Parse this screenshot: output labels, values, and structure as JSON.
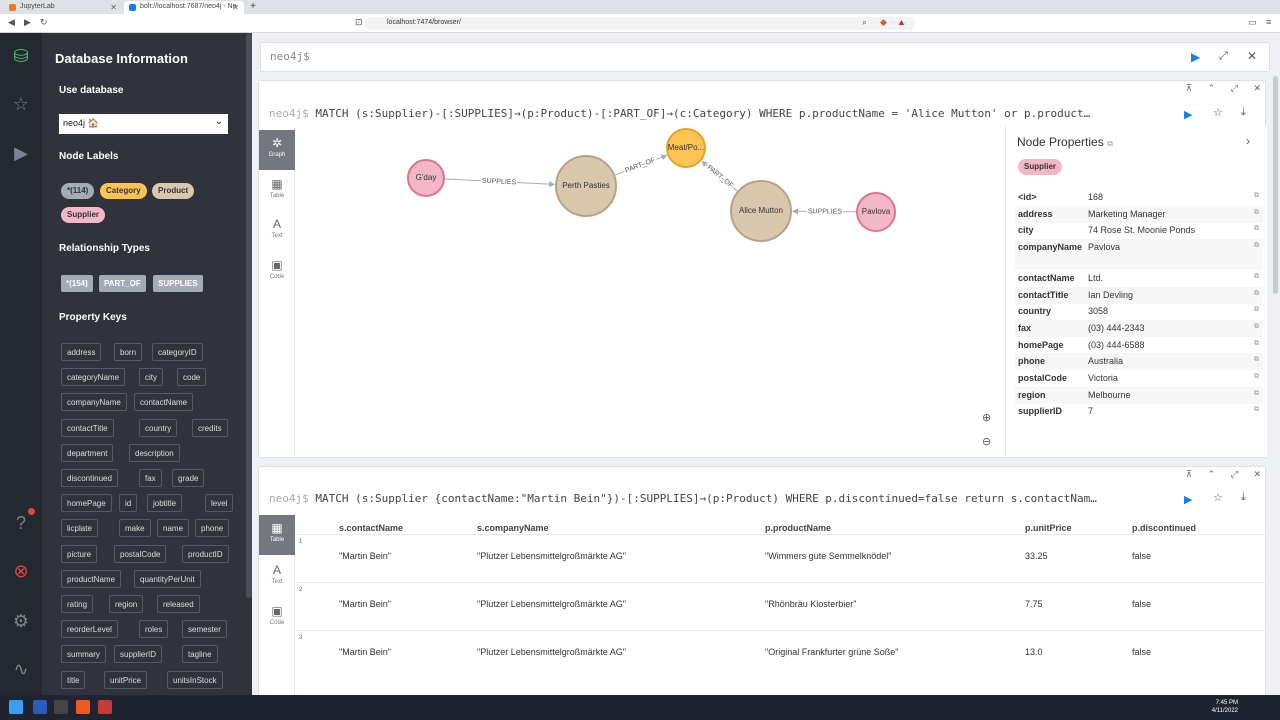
{
  "browser": {
    "tabs": [
      {
        "label": "JupyterLab",
        "color": "#f37726"
      },
      {
        "label": "bolt://localhost:7687/neo4j - Ne",
        "color": "#1581e6"
      }
    ],
    "url": "localhost:7474/browser/"
  },
  "sidebar": {
    "title": "Database Information",
    "use_database": "Use database",
    "db_value": "neo4j 🏠",
    "node_labels_title": "Node Labels",
    "node_labels": [
      {
        "label": "*(114)",
        "color": "#a5abb6"
      },
      {
        "label": "Category",
        "color": "#ffc454"
      },
      {
        "label": "Product",
        "color": "#d9c8ae"
      },
      {
        "label": "Supplier",
        "color": "#f3b7c8"
      }
    ],
    "rel_types_title": "Relationship Types",
    "rel_types": [
      "*(154)",
      "PART_OF",
      "SUPPLIES"
    ],
    "prop_keys_title": "Property Keys",
    "prop_keys": [
      [
        "address",
        "born",
        "categoryID"
      ],
      [
        "categoryName",
        "city",
        "code"
      ],
      [
        "companyName",
        "contactName"
      ],
      [
        "contactTitle",
        "country",
        "credits"
      ],
      [
        "department",
        "description"
      ],
      [
        "discontinued",
        "fax",
        "grade"
      ],
      [
        "homePage",
        "id",
        "jobtitle",
        "level"
      ],
      [
        "licplate",
        "make",
        "name",
        "phone"
      ],
      [
        "picture",
        "postalCode",
        "productID"
      ],
      [
        "productName",
        "quantityPerUnit"
      ],
      [
        "rating",
        "region",
        "released"
      ],
      [
        "reorderLevel",
        "roles",
        "semester"
      ],
      [
        "summary",
        "supplierID",
        "tagline"
      ],
      [
        "title",
        "unitPrice",
        "unitsInStock"
      ]
    ]
  },
  "editor": {
    "prompt": "neo4j$"
  },
  "frame1": {
    "query": "MATCH (s:Supplier)-[:SUPPLIES]→(p:Product)-[:PART_OF]→(c:Category) WHERE p.productName = 'Alice Mutton' or p.product…",
    "prompt": "neo4j$",
    "view_tabs": [
      "Graph",
      "Table",
      "Text",
      "Code"
    ],
    "graph": {
      "nodes": [
        {
          "id": "gday",
          "label": "G'day",
          "color": "#f3b7c8",
          "stroke": "#d9768f"
        },
        {
          "id": "perth",
          "label": "Perth Pasties",
          "color": "#d9c8ae",
          "stroke": "#b5a287"
        },
        {
          "id": "meat",
          "label": "Meat/Po...",
          "color": "#ffc454",
          "stroke": "#e0a42b"
        },
        {
          "id": "alice",
          "label": "Alice Mutton",
          "color": "#d9c8ae",
          "stroke": "#b5a287"
        },
        {
          "id": "pavlova",
          "label": "Pavlova",
          "color": "#f3b7c8",
          "stroke": "#d9768f"
        }
      ],
      "edges": [
        {
          "label": "SUPPLIES"
        },
        {
          "label": "PART_OF"
        },
        {
          "label": "PART_OF"
        },
        {
          "label": "SUPPLIES"
        }
      ]
    },
    "props": {
      "title": "Node Properties",
      "label": "Supplier",
      "rows": [
        {
          "k": "<id>",
          "v": "168"
        },
        {
          "k": "address",
          "v": "Marketing Manager"
        },
        {
          "k": "city",
          "v": "74 Rose St. Moonie Ponds"
        },
        {
          "k": "companyName",
          "v": "Pavlova"
        },
        {
          "k": "contactName",
          "v": "Ltd."
        },
        {
          "k": "contactTitle",
          "v": "Ian Devling"
        },
        {
          "k": "country",
          "v": "3058"
        },
        {
          "k": "fax",
          "v": "(03) 444-2343"
        },
        {
          "k": "homePage",
          "v": "(03) 444-6588"
        },
        {
          "k": "phone",
          "v": "Australia"
        },
        {
          "k": "postalCode",
          "v": "Victoria"
        },
        {
          "k": "region",
          "v": "Melbourne"
        },
        {
          "k": "supplierID",
          "v": "7"
        }
      ]
    }
  },
  "frame2": {
    "prompt": "neo4j$",
    "query": "MATCH (s:Supplier {contactName:\"Martin Bein\"})-[:SUPPLIES]→(p:Product) WHERE p.discontinued=false return s.contactNam…",
    "view_tabs": [
      "Table",
      "Text",
      "Code"
    ],
    "columns": [
      "s.contactName",
      "s.companyName",
      "p.productName",
      "p.unitPrice",
      "p.discontinued"
    ],
    "rows": [
      {
        "n": "1",
        "cells": [
          "\"Martin Bein\"",
          "\"Plutzer Lebensmittelgroßmärkte AG\"",
          "\"Wimmers gute Semmelknödel\"",
          "33.25",
          "false"
        ]
      },
      {
        "n": "2",
        "cells": [
          "\"Martin Bein\"",
          "\"Plutzer Lebensmittelgroßmärkte AG\"",
          "\"Rhönbräu Klosterbier\"",
          "7.75",
          "false"
        ]
      },
      {
        "n": "3",
        "cells": [
          "\"Martin Bein\"",
          "\"Plutzer Lebensmittelgroßmärkte AG\"",
          "\"Original Frankfurter grüne Soße\"",
          "13.0",
          "false"
        ]
      }
    ]
  },
  "taskbar": {
    "time": "7:45 PM",
    "date": "4/11/2022"
  }
}
